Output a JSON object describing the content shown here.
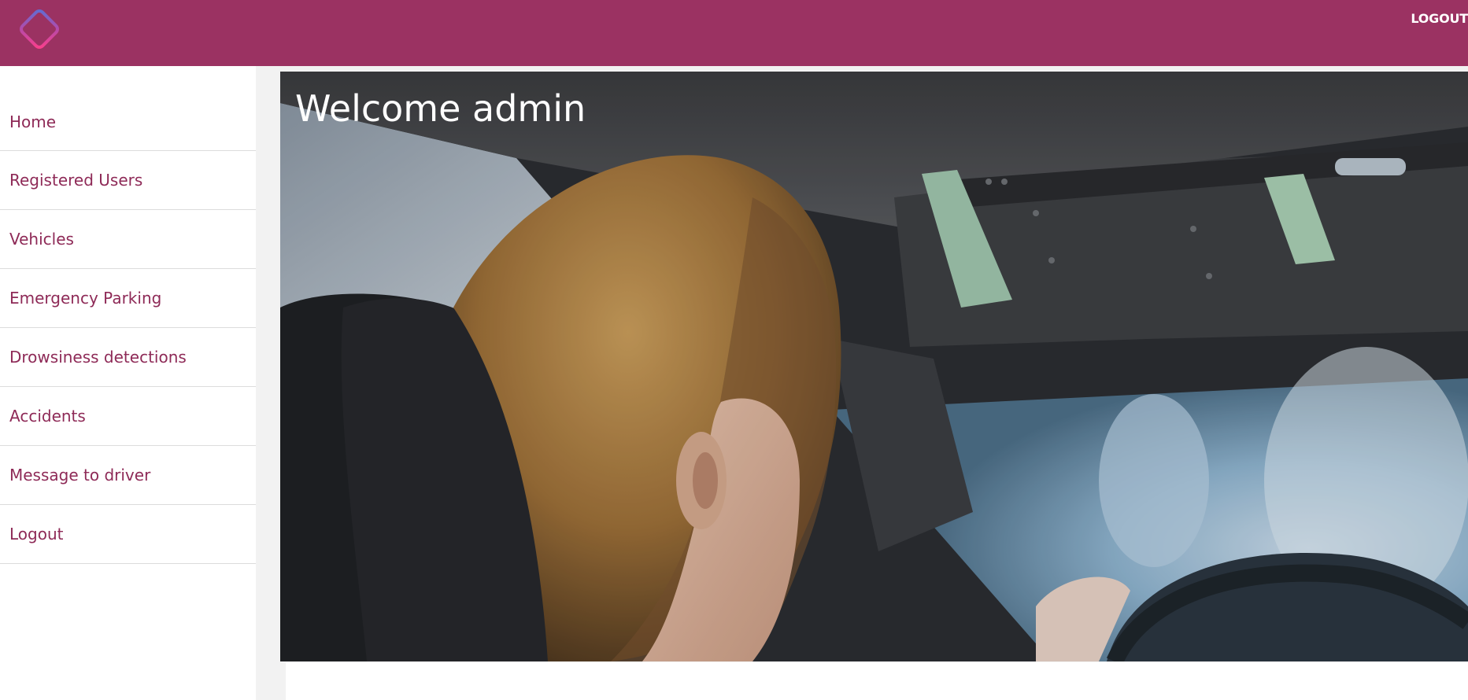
{
  "header": {
    "logout_label": "LOGOUT",
    "brand_color": "#9b3262",
    "logo_icon": "diamond-logo-icon"
  },
  "sidebar": {
    "items": [
      {
        "label": "Home"
      },
      {
        "label": "Registered Users"
      },
      {
        "label": "Vehicles"
      },
      {
        "label": "Emergency Parking"
      },
      {
        "label": "Drowsiness detections"
      },
      {
        "label": "Accidents"
      },
      {
        "label": "Message to driver"
      },
      {
        "label": "Logout"
      }
    ],
    "link_color": "#8e2a57"
  },
  "main": {
    "welcome_text": "Welcome admin"
  }
}
